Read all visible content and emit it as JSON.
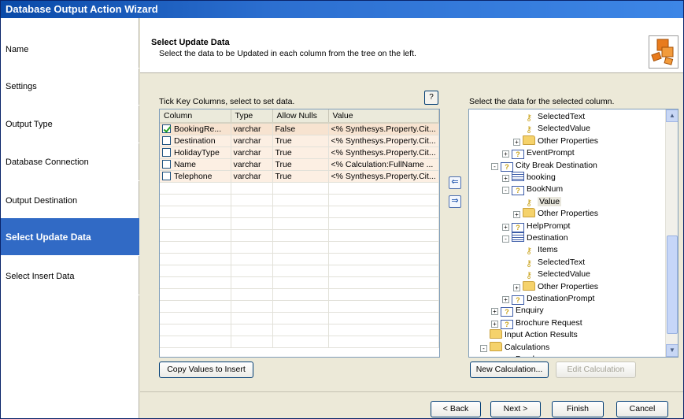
{
  "window": {
    "title": "Database Output Action Wizard"
  },
  "steps": [
    {
      "label": "Name"
    },
    {
      "label": "Settings"
    },
    {
      "label": "Output Type"
    },
    {
      "label": "Database Connection"
    },
    {
      "label": "Output Destination"
    },
    {
      "label": "Select Update Data",
      "active": true
    },
    {
      "label": "Select Insert Data"
    }
  ],
  "header": {
    "title": "Select Update Data",
    "subtitle": "Select the data to be Updated in each column from the tree on the left."
  },
  "help_label": "?",
  "left_caption": "Tick Key Columns, select to set data.",
  "right_caption": "Select the data for the selected column.",
  "grid": {
    "columns": [
      "Column",
      "Type",
      "Allow Nulls",
      "Value"
    ],
    "rows": [
      {
        "checked": true,
        "column": "BookingRe...",
        "type": "varchar",
        "nulls": "False",
        "value": "<% Synthesys.Property.Cit..."
      },
      {
        "checked": false,
        "column": "Destination",
        "type": "varchar",
        "nulls": "True",
        "value": "<% Synthesys.Property.Cit..."
      },
      {
        "checked": false,
        "column": "HolidayType",
        "type": "varchar",
        "nulls": "True",
        "value": "<% Synthesys.Property.Cit..."
      },
      {
        "checked": false,
        "column": "Name",
        "type": "varchar",
        "nulls": "True",
        "value": "<% Calculation:FullName ..."
      },
      {
        "checked": false,
        "column": "Telephone",
        "type": "varchar",
        "nulls": "True",
        "value": "<% Synthesys.Property.Cit..."
      }
    ]
  },
  "tree": [
    {
      "label": "SelectedText",
      "indent": 5,
      "icon": "key",
      "expander": ""
    },
    {
      "label": "SelectedValue",
      "indent": 5,
      "icon": "key",
      "expander": ""
    },
    {
      "label": "Other Properties",
      "indent": 5,
      "icon": "folder",
      "expander": "+"
    },
    {
      "label": "EventPrompt",
      "indent": 4,
      "icon": "prompt",
      "expander": "+"
    },
    {
      "label": "City Break Destination",
      "indent": 3,
      "icon": "prompt",
      "expander": "-"
    },
    {
      "label": "booking",
      "indent": 4,
      "icon": "list",
      "expander": "+"
    },
    {
      "label": "BookNum",
      "indent": 4,
      "icon": "prompt",
      "expander": "-"
    },
    {
      "label": "Value",
      "indent": 5,
      "icon": "key",
      "expander": "",
      "selected": true
    },
    {
      "label": "Other Properties",
      "indent": 5,
      "icon": "folder",
      "expander": "+"
    },
    {
      "label": "HelpPrompt",
      "indent": 4,
      "icon": "prompt",
      "expander": "+"
    },
    {
      "label": "Destination",
      "indent": 4,
      "icon": "list",
      "expander": "-"
    },
    {
      "label": "Items",
      "indent": 5,
      "icon": "key",
      "expander": ""
    },
    {
      "label": "SelectedText",
      "indent": 5,
      "icon": "key",
      "expander": ""
    },
    {
      "label": "SelectedValue",
      "indent": 5,
      "icon": "key",
      "expander": ""
    },
    {
      "label": "Other Properties",
      "indent": 5,
      "icon": "folder",
      "expander": "+"
    },
    {
      "label": "DestinationPrompt",
      "indent": 4,
      "icon": "prompt",
      "expander": "+"
    },
    {
      "label": "Enquiry",
      "indent": 3,
      "icon": "prompt",
      "expander": "+"
    },
    {
      "label": "Brochure Request",
      "indent": 3,
      "icon": "prompt",
      "expander": "+"
    },
    {
      "label": "Input Action Results",
      "indent": 2,
      "icon": "folder",
      "expander": ""
    },
    {
      "label": "Calculations",
      "indent": 2,
      "icon": "folder",
      "expander": "-"
    },
    {
      "label": "Brochure",
      "indent": 3,
      "icon": "key",
      "expander": ""
    }
  ],
  "buttons": {
    "copy_values": "Copy Values to Insert",
    "new_calc": "New Calculation...",
    "edit_calc": "Edit Calculation",
    "back": "< Back",
    "next": "Next >",
    "finish": "Finish",
    "cancel": "Cancel"
  },
  "icons": {
    "move_left": "⇐",
    "move_right": "⇒",
    "scroll_up": "▲",
    "scroll_down": "▼"
  },
  "colors": {
    "title_bar": "#0a4aa8",
    "active_step": "#316ac5",
    "row_fill": "#fcefe3"
  }
}
